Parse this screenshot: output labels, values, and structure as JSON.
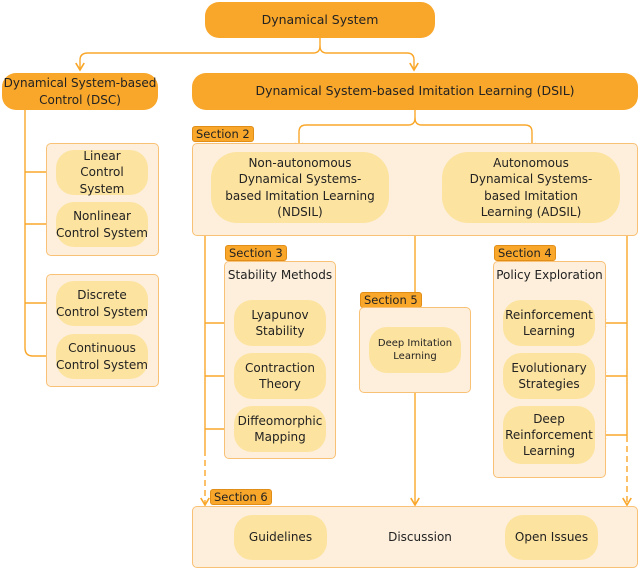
{
  "nodes": {
    "root": "Dynamical System",
    "dsc": "Dynamical System-based Control (DSC)",
    "dsil": "Dynamical System-based Imitation Learning (DSIL)",
    "linear": "Linear Control System",
    "nonlinear": "Nonlinear Control System",
    "discrete": "Discrete Control System",
    "continuous": "Continuous Control System",
    "ndsil": "Non-autonomous Dynamical Systems-based Imitation Learning (NDSIL)",
    "adsil": "Autonomous Dynamical Systems-based Imitation Learning (ADSIL)",
    "stability_title": "Stability Methods",
    "lyapunov": "Lyapunov Stability",
    "contraction": "Contraction Theory",
    "diffeo": "Diffeomorphic Mapping",
    "deep_il": "Deep Imitation Learning",
    "policy_title": "Policy Exploration",
    "rl": "Reinforcement Learning",
    "es": "Evolutionary Strategies",
    "drl": "Deep Reinforcement Learning",
    "guidelines": "Guidelines",
    "discussion": "Discussion",
    "open_issues": "Open Issues"
  },
  "sections": {
    "s2": "Section 2",
    "s3": "Section 3",
    "s4": "Section 4",
    "s5": "Section 5",
    "s6": "Section 6"
  },
  "colors": {
    "primary": "#f9a72a",
    "group_fill": "#fdefdc",
    "pill_fill": "#fde3a0"
  }
}
